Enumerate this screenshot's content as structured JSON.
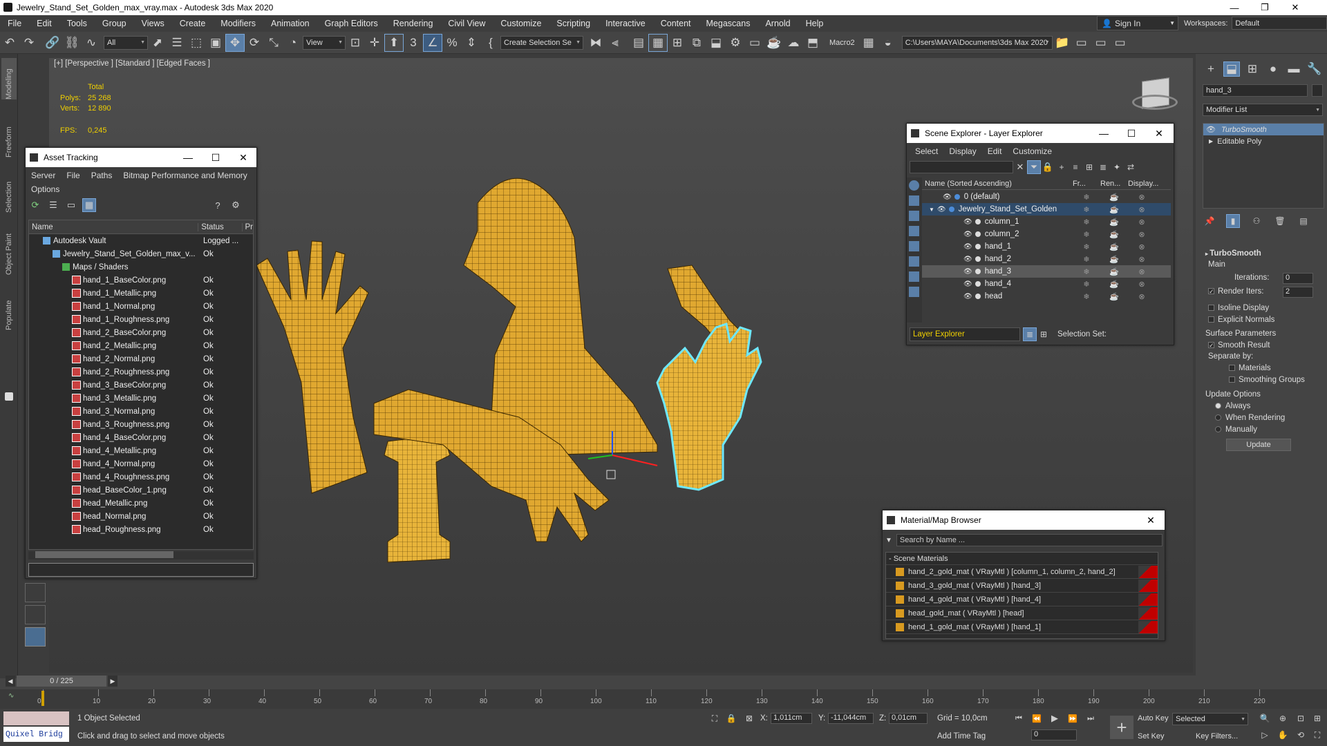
{
  "window": {
    "title": "Jewelry_Stand_Set_Golden_max_vray.max - Autodesk 3ds Max 2020"
  },
  "menu": [
    "File",
    "Edit",
    "Tools",
    "Group",
    "Views",
    "Create",
    "Modifiers",
    "Animation",
    "Graph Editors",
    "Rendering",
    "Civil View",
    "Customize",
    "Scripting",
    "Interactive",
    "Content",
    "Megascans",
    "Arnold",
    "Help"
  ],
  "account": {
    "signin": "Sign In",
    "workspaces_label": "Workspaces:",
    "workspace": "Default"
  },
  "toolbar": {
    "filter": "All",
    "refcoord": "View",
    "selset": "Create Selection Se",
    "macro": "Macro2",
    "path": "C:\\Users\\MAYA\\Documents\\3ds Max 2020"
  },
  "left_tabs": [
    "Modeling",
    "Freeform",
    "Selection",
    "Object Paint",
    "Populate"
  ],
  "viewport": {
    "label": "[+] [Perspective ] [Standard ] [Edged Faces ]",
    "stats": {
      "total_label": "Total",
      "polys_label": "Polys:",
      "polys": "25 268",
      "verts_label": "Verts:",
      "verts": "12 890",
      "fps_label": "FPS:",
      "fps": "0,245"
    }
  },
  "asset_tracking": {
    "title": "Asset Tracking",
    "menu": [
      "Server",
      "File",
      "Paths",
      "Bitmap Performance and Memory"
    ],
    "menu2": "Options",
    "cols": [
      "Name",
      "Status",
      "Pr"
    ],
    "rows": [
      {
        "name": "Autodesk Vault",
        "status": "Logged ...",
        "indent": 1
      },
      {
        "name": "Jewelry_Stand_Set_Golden_max_v...",
        "status": "Ok",
        "indent": 2
      },
      {
        "name": "Maps / Shaders",
        "status": "",
        "indent": 3
      },
      {
        "name": "hand_1_BaseColor.png",
        "status": "Ok",
        "indent": 4
      },
      {
        "name": "hand_1_Metallic.png",
        "status": "Ok",
        "indent": 4
      },
      {
        "name": "hand_1_Normal.png",
        "status": "Ok",
        "indent": 4
      },
      {
        "name": "hand_1_Roughness.png",
        "status": "Ok",
        "indent": 4
      },
      {
        "name": "hand_2_BaseColor.png",
        "status": "Ok",
        "indent": 4
      },
      {
        "name": "hand_2_Metallic.png",
        "status": "Ok",
        "indent": 4
      },
      {
        "name": "hand_2_Normal.png",
        "status": "Ok",
        "indent": 4
      },
      {
        "name": "hand_2_Roughness.png",
        "status": "Ok",
        "indent": 4
      },
      {
        "name": "hand_3_BaseColor.png",
        "status": "Ok",
        "indent": 4
      },
      {
        "name": "hand_3_Metallic.png",
        "status": "Ok",
        "indent": 4
      },
      {
        "name": "hand_3_Normal.png",
        "status": "Ok",
        "indent": 4
      },
      {
        "name": "hand_3_Roughness.png",
        "status": "Ok",
        "indent": 4
      },
      {
        "name": "hand_4_BaseColor.png",
        "status": "Ok",
        "indent": 4
      },
      {
        "name": "hand_4_Metallic.png",
        "status": "Ok",
        "indent": 4
      },
      {
        "name": "hand_4_Normal.png",
        "status": "Ok",
        "indent": 4
      },
      {
        "name": "hand_4_Roughness.png",
        "status": "Ok",
        "indent": 4
      },
      {
        "name": "head_BaseColor_1.png",
        "status": "Ok",
        "indent": 4
      },
      {
        "name": "head_Metallic.png",
        "status": "Ok",
        "indent": 4
      },
      {
        "name": "head_Normal.png",
        "status": "Ok",
        "indent": 4
      },
      {
        "name": "head_Roughness.png",
        "status": "Ok",
        "indent": 4
      }
    ]
  },
  "scene_explorer": {
    "title": "Scene Explorer - Layer Explorer",
    "menu": [
      "Select",
      "Display",
      "Edit",
      "Customize"
    ],
    "cols": [
      "Name (Sorted Ascending)",
      "Fr...",
      "Ren...",
      "Display..."
    ],
    "rows": [
      {
        "name": "0 (default)",
        "level": 0,
        "selected": false
      },
      {
        "name": "Jewelry_Stand_Set_Golden",
        "level": 0,
        "selected": false,
        "layer": true
      },
      {
        "name": "column_1",
        "level": 1,
        "selected": false
      },
      {
        "name": "column_2",
        "level": 1,
        "selected": false
      },
      {
        "name": "hand_1",
        "level": 1,
        "selected": false
      },
      {
        "name": "hand_2",
        "level": 1,
        "selected": false
      },
      {
        "name": "hand_3",
        "level": 1,
        "selected": true
      },
      {
        "name": "hand_4",
        "level": 1,
        "selected": false
      },
      {
        "name": "head",
        "level": 1,
        "selected": false
      }
    ],
    "footer": {
      "explorer": "Layer Explorer",
      "selset_label": "Selection Set:"
    }
  },
  "material_browser": {
    "title": "Material/Map Browser",
    "search": "Search by Name ...",
    "group": "- Scene Materials",
    "items": [
      "hand_2_gold_mat  ( VRayMtl ) [column_1, column_2, hand_2]",
      "hand_3_gold_mat  ( VRayMtl ) [hand_3]",
      "hand_4_gold_mat  ( VRayMtl ) [hand_4]",
      "head_gold_mat  ( VRayMtl ) [head]",
      "hend_1_gold_mat  ( VRayMtl ) [hand_1]"
    ]
  },
  "command_panel": {
    "object_name": "hand_3",
    "modifier_list": "Modifier List",
    "stack": [
      "TurboSmooth",
      "Editable Poly"
    ],
    "rollout": "TurboSmooth",
    "main": "Main",
    "iterations_label": "Iterations:",
    "iterations": "0",
    "render_iters_label": "Render Iters:",
    "render_iters": "2",
    "isoline": "Isoline Display",
    "explicit": "Explicit Normals",
    "surface": "Surface Parameters",
    "smooth_result": "Smooth Result",
    "separate": "Separate by:",
    "materials": "Materials",
    "smoothing": "Smoothing Groups",
    "update_options": "Update Options",
    "always": "Always",
    "when_rendering": "When Rendering",
    "manually": "Manually",
    "update_btn": "Update"
  },
  "timeline": {
    "frame": "0 / 225",
    "ticks": [
      "0",
      "10",
      "20",
      "30",
      "40",
      "50",
      "60",
      "70",
      "80",
      "90",
      "100",
      "110",
      "120",
      "130",
      "140",
      "150",
      "160",
      "170",
      "180",
      "190",
      "200",
      "210",
      "220"
    ]
  },
  "status": {
    "quixel": "Quixel Bridg",
    "selected": "1 Object Selected",
    "prompt": "Click and drag to select and move objects",
    "x_label": "X:",
    "x": "1,011cm",
    "y_label": "Y:",
    "y": "-11,044cm",
    "z_label": "Z:",
    "z": "0,01cm",
    "grid": "Grid = 10,0cm",
    "add_time_tag": "Add Time Tag",
    "auto_key": "Auto Key",
    "set_key": "Set Key",
    "key_mode": "Selected",
    "key_filters": "Key Filters...",
    "frame_field": "0"
  }
}
